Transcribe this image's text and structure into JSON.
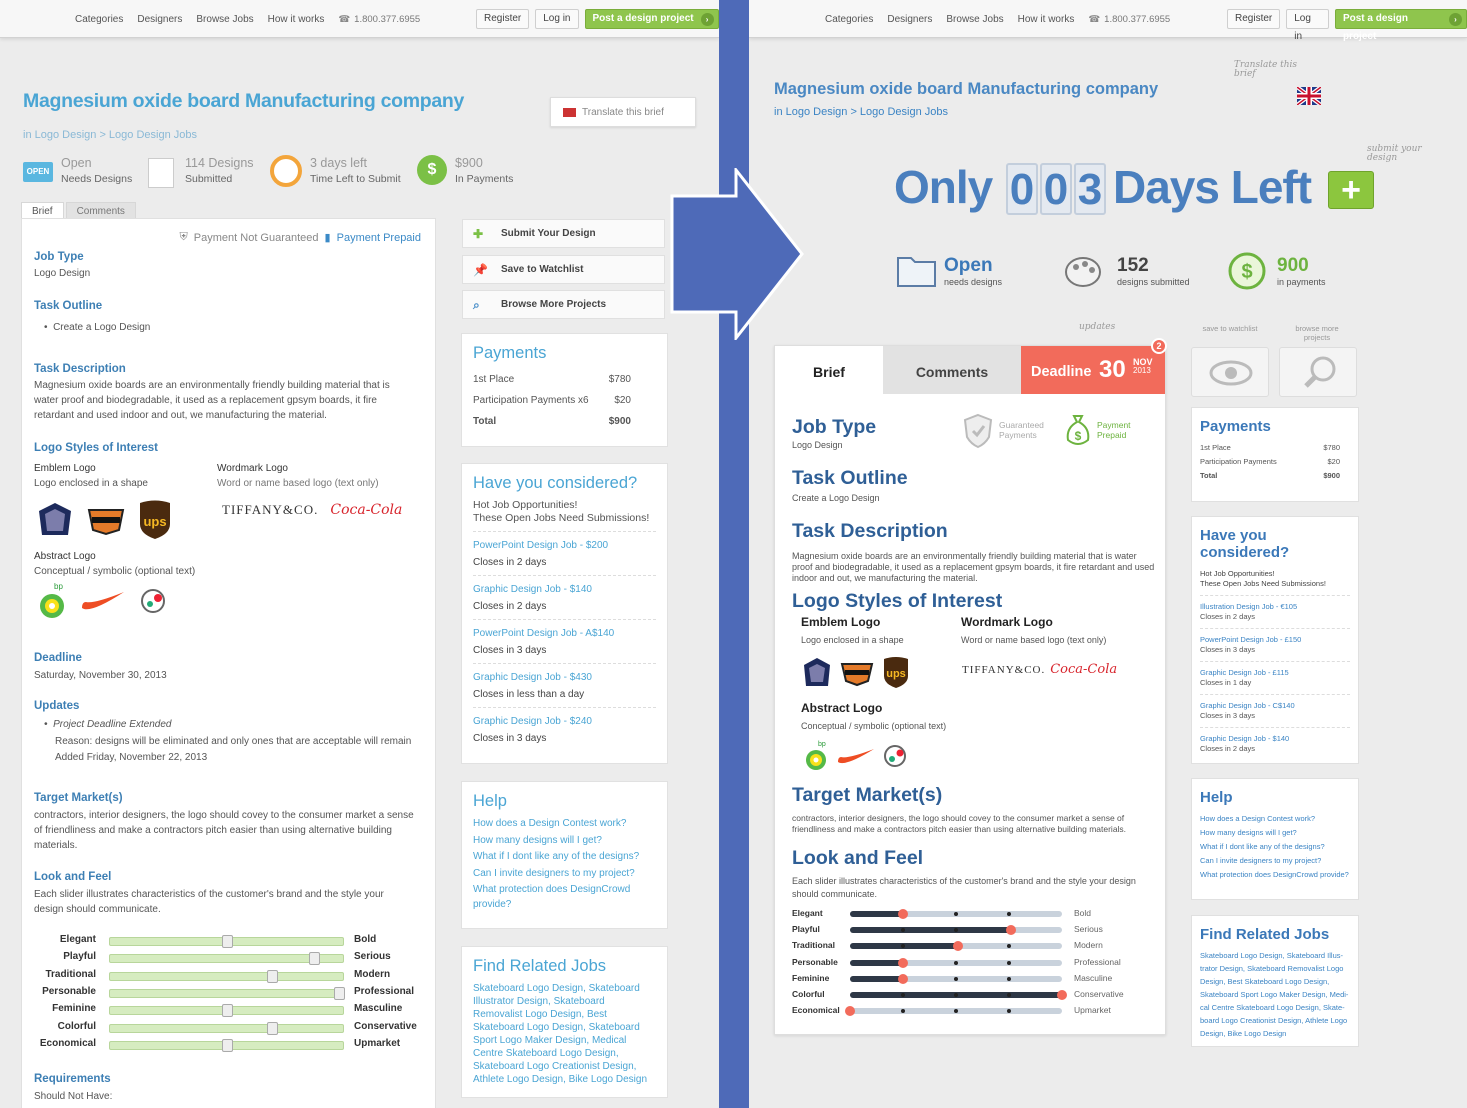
{
  "nav": {
    "categories": "Categories",
    "designers": "Designers",
    "browse": "Browse Jobs",
    "how": "How it works",
    "phone": "1.800.377.6955",
    "register": "Register",
    "login": "Log in",
    "post": "Post a design project"
  },
  "left": {
    "title": "Magnesium oxide board Manufacturing company",
    "crumb": "in Logo Design > Logo Design Jobs",
    "translate": "Translate this brief",
    "stats": [
      {
        "value": "Open",
        "label": "Needs Designs",
        "badge": "OPEN"
      },
      {
        "value": "114 Designs",
        "label": "Submitted"
      },
      {
        "value": "3 days left",
        "label": "Time Left to Submit"
      },
      {
        "value": "$900",
        "label": "In Payments",
        "icon": "$"
      }
    ],
    "tabs": [
      "Brief",
      "Comments"
    ],
    "payment_not": "Payment Not Guaranteed",
    "payment_prepaid": "Payment Prepaid",
    "job_type_h": "Job Type",
    "job_type": "Logo Design",
    "task_outline_h": "Task Outline",
    "task_outline": "Create a Logo Design",
    "task_desc_h": "Task Description",
    "task_desc_1": "Magnesium oxide boards are an environmentally friendly building material that is",
    "task_desc_2": "water proof and biodegradable, it used as a replacement gpsym boards, it fire",
    "task_desc_3": "retardant and used indoor and out, we manufacturing the material.",
    "logo_styles_h": "Logo Styles of Interest",
    "emblem_h": "Emblem Logo",
    "emblem": "Logo enclosed in a shape",
    "wordmark_h": "Wordmark Logo",
    "wordmark": "Word or name based logo (text only)",
    "abstract_h": "Abstract Logo",
    "abstract": "Conceptual / symbolic (optional text)",
    "tiffany": "TIFFANY&CO.",
    "cocacola": "Coca-Cola",
    "bp": "bp",
    "ups": "ups",
    "deadline_h": "Deadline",
    "deadline": "Saturday, November 30, 2013",
    "updates_h": "Updates",
    "updates_1": "Project Deadline Extended",
    "updates_2": "Reason: designs will be eliminated and only ones that are acceptable will remain",
    "updates_3": "Added Friday, November 22, 2013",
    "target_h": "Target Market(s)",
    "target_1": "contractors, interior designers, the logo should covey to the consumer market a sense",
    "target_2": "of friendliness and make a contractors pitch easier than using alternative building",
    "target_3": "materials.",
    "look_h": "Look and Feel",
    "look_1": "Each slider illustrates characteristics of the customer's brand and the style your",
    "look_2": "design should communicate.",
    "req_h": "Requirements",
    "req": "Should Not Have:",
    "actions": [
      "Submit Your Design",
      "Save to Watchlist",
      "Browse More Projects"
    ],
    "payments_h": "Payments",
    "payments": [
      [
        "1st Place",
        "$780"
      ],
      [
        "Participation Payments x6",
        "$20"
      ],
      [
        "Total",
        "$900"
      ]
    ],
    "considered_h": "Have you considered?",
    "considered_1": "Hot Job Opportunities!",
    "considered_2": "These Open Jobs Need Submissions!",
    "jobs": [
      {
        "name": "PowerPoint Design Job",
        "price": " - $200",
        "closes": "Closes in 2 days"
      },
      {
        "name": "Graphic Design Job",
        "price": " - $140",
        "closes": "Closes in 2 days"
      },
      {
        "name": "PowerPoint Design Job",
        "price": " - A$140",
        "closes": "Closes in 3 days"
      },
      {
        "name": "Graphic Design Job",
        "price": " - $430",
        "closes": "Closes in less than a day"
      },
      {
        "name": "Graphic Design Job",
        "price": " - $240",
        "closes": "Closes in 3 days"
      }
    ],
    "help_h": "Help",
    "help": [
      "How does a Design Contest work?",
      "How many designs will I get?",
      "What if I dont like any of the designs?",
      "Can I invite designers to my project?",
      "What protection does DesignCrowd",
      "provide?"
    ],
    "related_h": "Find Related Jobs",
    "related": [
      "Skateboard Logo Design,  Skateboard",
      "Illustrator Design,  Skateboard",
      "Removalist Logo Design,  Best",
      "Skateboard Logo Design,  Skateboard",
      "Sport Logo Maker Design,  Medical",
      "Centre Skateboard Logo Design,",
      "Skateboard Logo Creationist Design,",
      "Athlete Logo Design,  Bike Logo Design"
    ],
    "sliders": [
      {
        "left": "Elegant",
        "right": "Bold",
        "value": 0.5
      },
      {
        "left": "Playful",
        "right": "Serious",
        "value": 0.89
      },
      {
        "left": "Traditional",
        "right": "Modern",
        "value": 0.7
      },
      {
        "left": "Personable",
        "right": "Professional",
        "value": 1.0
      },
      {
        "left": "Feminine",
        "right": "Masculine",
        "value": 0.5
      },
      {
        "left": "Colorful",
        "right": "Conservative",
        "value": 0.7
      },
      {
        "left": "Economical",
        "right": "Upmarket",
        "value": 0.5
      }
    ]
  },
  "right": {
    "title": "Magnesium oxide board Manufacturing company",
    "crumb": "in Logo Design > Logo Design Jobs",
    "translate_note": "Translate this brief",
    "submit_note": "submit your design",
    "only": "Only",
    "digits": [
      "0",
      "0",
      "3"
    ],
    "days_left": "Days Left",
    "plus": "+",
    "stats": [
      {
        "value": "Open",
        "label": "needs designs"
      },
      {
        "value": "152",
        "label": "designs submitted"
      },
      {
        "value": "900",
        "label": "in payments"
      }
    ],
    "updates_note": "updates",
    "updates_count": "2",
    "watch_note": "save to watchlist",
    "browse_note": "browse more projects",
    "tabs": {
      "brief": "Brief",
      "comments": "Comments",
      "deadline": "Deadline",
      "day": "30",
      "month": "NOV",
      "year": "2013"
    },
    "guaranteed": "Guaranteed Payments",
    "prepaid": "Payment Prepaid",
    "job_type_h": "Job Type",
    "job_type": "Logo Design",
    "task_outline_h": "Task Outline",
    "task_outline": "Create a Logo Design",
    "task_desc_h": "Task Description",
    "task_desc_1": "Magnesium oxide boards are an environmentally friendly building material that is water",
    "task_desc_2": "proof and biodegradable, it used as a replacement gpsym boards, it fire retardant and used",
    "task_desc_3": "indoor and out, we manufacturing the material.",
    "logo_styles_h": "Logo Styles of Interest",
    "emblem_h": "Emblem Logo",
    "emblem": "Logo enclosed in a shape",
    "wordmark_h": "Wordmark Logo",
    "wordmark": "Word or name based logo (text only)",
    "abstract_h": "Abstract Logo",
    "abstract": "Conceptual / symbolic (optional text)",
    "target_h": "Target Market(s)",
    "target_1": "contractors, interior designers, the logo should covey to the consumer market a sense of",
    "target_2": "friendliness and make a contractors pitch easier than using alternative building materials.",
    "look_h": "Look and Feel",
    "look_1": "Each slider illustrates characteristics of the customer's brand and the style your design",
    "look_2": "should communicate.",
    "sliders": [
      {
        "left": "Elegant",
        "right": "Bold",
        "value": 0.25
      },
      {
        "left": "Playful",
        "right": "Serious",
        "value": 0.76
      },
      {
        "left": "Traditional",
        "right": "Modern",
        "value": 0.51
      },
      {
        "left": "Personable",
        "right": "Professional",
        "value": 0.25
      },
      {
        "left": "Feminine",
        "right": "Masculine",
        "value": 0.25
      },
      {
        "left": "Colorful",
        "right": "Conservative",
        "value": 1.0
      },
      {
        "left": "Economical",
        "right": "Upmarket",
        "value": 0.0
      }
    ],
    "payments_h": "Payments",
    "payments": [
      [
        "1st Place",
        "$780"
      ],
      [
        "Participation Payments",
        "$20"
      ],
      [
        "Total",
        "$900"
      ]
    ],
    "considered_h": "Have you considered?",
    "considered_1": "Hot Job Opportunities!",
    "considered_2": "These Open Jobs Need Submissions!",
    "jobs": [
      {
        "name": "Illustration Design Job",
        "price": " - €105",
        "closes": "Closes in 2 days"
      },
      {
        "name": "PowerPoint Design Job",
        "price": " - £150",
        "closes": "Closes in 3 days"
      },
      {
        "name": "Graphic Design Job",
        "price": " - £115",
        "closes": "Closes in 1 day"
      },
      {
        "name": "Graphic Design Job",
        "price": " - C$140",
        "closes": "Closes in 3 days"
      },
      {
        "name": "Graphic Design Job",
        "price": " - $140",
        "closes": "Closes in 2 days"
      }
    ],
    "help_h": "Help",
    "help": [
      "How does a Design Contest work?",
      "How many designs will I get?",
      "What if I dont like any of the designs?",
      "Can I invite designers to my project?",
      "What protection does DesignCrowd provide?"
    ],
    "related_h": "Find Related Jobs",
    "related": [
      "Skateboard Logo Design, Skateboard Illus-",
      "trator Design, Skateboard Removalist Logo",
      "Design, Best Skateboard Logo Design,",
      "Skateboard Sport Logo Maker Design, Medi-",
      "cal Centre Skateboard Logo Design, Skate-",
      "board Logo Creationist Design, Athlete Logo",
      "Design, Bike Logo Design"
    ]
  },
  "colors": {
    "separator": "#4e6ab8",
    "green": "#8fc54d",
    "link": "#4aa5d4",
    "deadline": "#f26b5b",
    "heading": "#2f5f96"
  }
}
